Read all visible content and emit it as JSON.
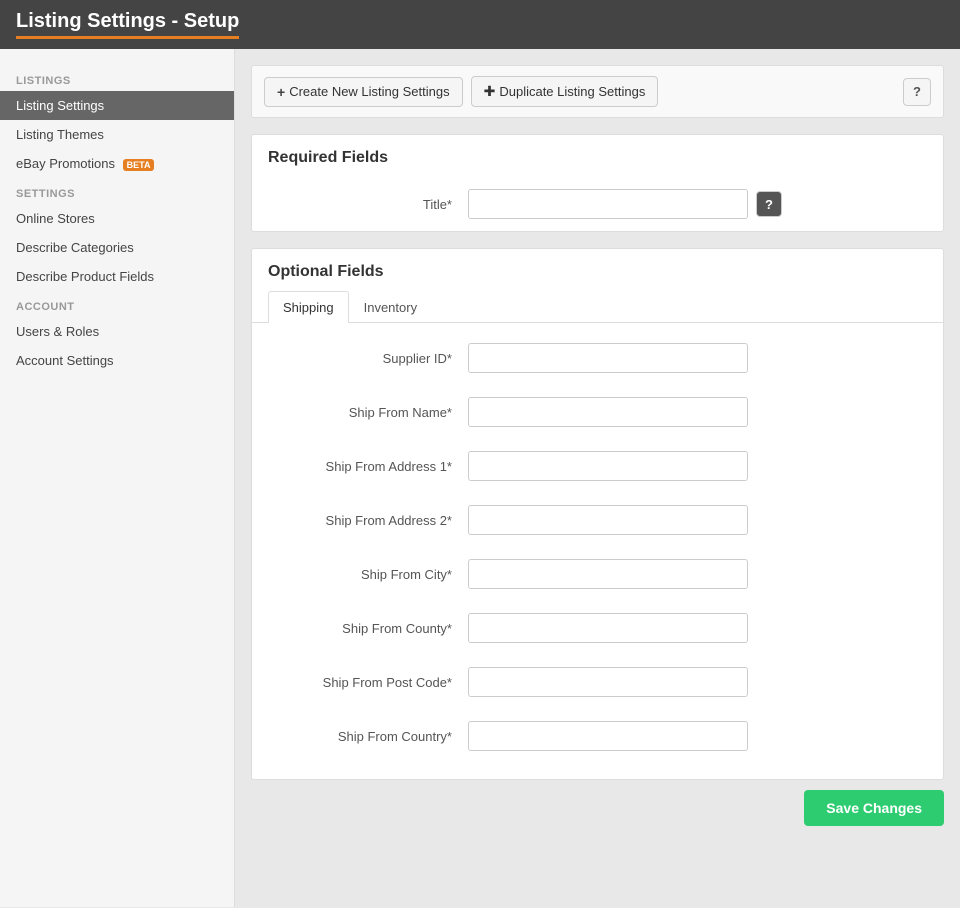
{
  "header": {
    "title": "Listing Settings - Setup"
  },
  "sidebar": {
    "sections": [
      {
        "label": "Listings",
        "items": [
          {
            "id": "listing-settings",
            "label": "Listing Settings",
            "active": true,
            "beta": false
          },
          {
            "id": "listing-themes",
            "label": "Listing Themes",
            "active": false,
            "beta": false
          },
          {
            "id": "ebay-promotions",
            "label": "eBay Promotions",
            "active": false,
            "beta": true
          }
        ]
      },
      {
        "label": "Settings",
        "items": [
          {
            "id": "online-stores",
            "label": "Online Stores",
            "active": false,
            "beta": false
          },
          {
            "id": "describe-categories",
            "label": "Describe Categories",
            "active": false,
            "beta": false
          },
          {
            "id": "describe-product-fields",
            "label": "Describe Product Fields",
            "active": false,
            "beta": false
          }
        ]
      },
      {
        "label": "Account",
        "items": [
          {
            "id": "users-roles",
            "label": "Users & Roles",
            "active": false,
            "beta": false
          },
          {
            "id": "account-settings",
            "label": "Account Settings",
            "active": false,
            "beta": false
          }
        ]
      }
    ]
  },
  "toolbar": {
    "create_label": "Create New Listing Settings",
    "duplicate_label": "Duplicate Listing Settings",
    "help_icon": "?"
  },
  "required_fields": {
    "heading": "Required Fields",
    "fields": [
      {
        "id": "title",
        "label": "Title*",
        "value": "",
        "has_help": true
      }
    ]
  },
  "optional_fields": {
    "heading": "Optional Fields",
    "tabs": [
      {
        "id": "shipping",
        "label": "Shipping",
        "active": true
      },
      {
        "id": "inventory",
        "label": "Inventory",
        "active": false
      }
    ],
    "shipping_fields": [
      {
        "id": "supplier-id",
        "label": "Supplier ID*",
        "value": ""
      },
      {
        "id": "ship-from-name",
        "label": "Ship From Name*",
        "value": ""
      },
      {
        "id": "ship-from-address1",
        "label": "Ship From Address 1*",
        "value": ""
      },
      {
        "id": "ship-from-address2",
        "label": "Ship From Address 2*",
        "value": ""
      },
      {
        "id": "ship-from-city",
        "label": "Ship From City*",
        "value": ""
      },
      {
        "id": "ship-from-county",
        "label": "Ship From County*",
        "value": ""
      },
      {
        "id": "ship-from-post-code",
        "label": "Ship From Post Code*",
        "value": ""
      },
      {
        "id": "ship-from-country",
        "label": "Ship From Country*",
        "value": ""
      }
    ]
  },
  "footer": {
    "save_label": "Save Changes"
  }
}
